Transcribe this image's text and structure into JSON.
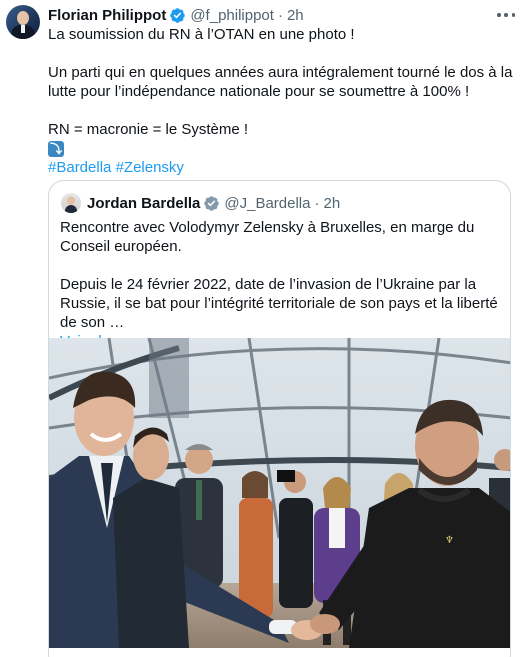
{
  "tweet": {
    "author_name": "Florian Philippot",
    "handle": "@f_philippot",
    "separator": "·",
    "time": "2h",
    "line1": "La soumission du RN à l’OTAN en une photo !",
    "line2": "Un parti qui en quelques années aura intégralement tourné le dos à la lutte pour l’indépendance nationale pour se soumettre à 100% !",
    "line3": "RN = macronie = le Système !",
    "emoji": "⤵",
    "hashtag1": "#Bardella",
    "hashtag2": "#Zelensky"
  },
  "quote": {
    "author_name": "Jordan Bardella",
    "handle": "@J_Bardella",
    "separator": "·",
    "time": "2h",
    "line1": "Rencontre avec Volodymyr Zelensky à Bruxelles, en marge du Conseil européen.",
    "line2": "Depuis le 24 février 2022, date de l’invasion de l’Ukraine par la Russie, il se bat pour l’intégrité territoriale de son pays et la liberté de son …",
    "see_more": "Voir plus"
  },
  "colors": {
    "accent": "#1d9bf0",
    "text": "#0f1419",
    "secondary": "#536471",
    "border": "#cfd9de"
  },
  "icons": {
    "verified": "verified-badge-icon",
    "more": "more-options-icon"
  }
}
